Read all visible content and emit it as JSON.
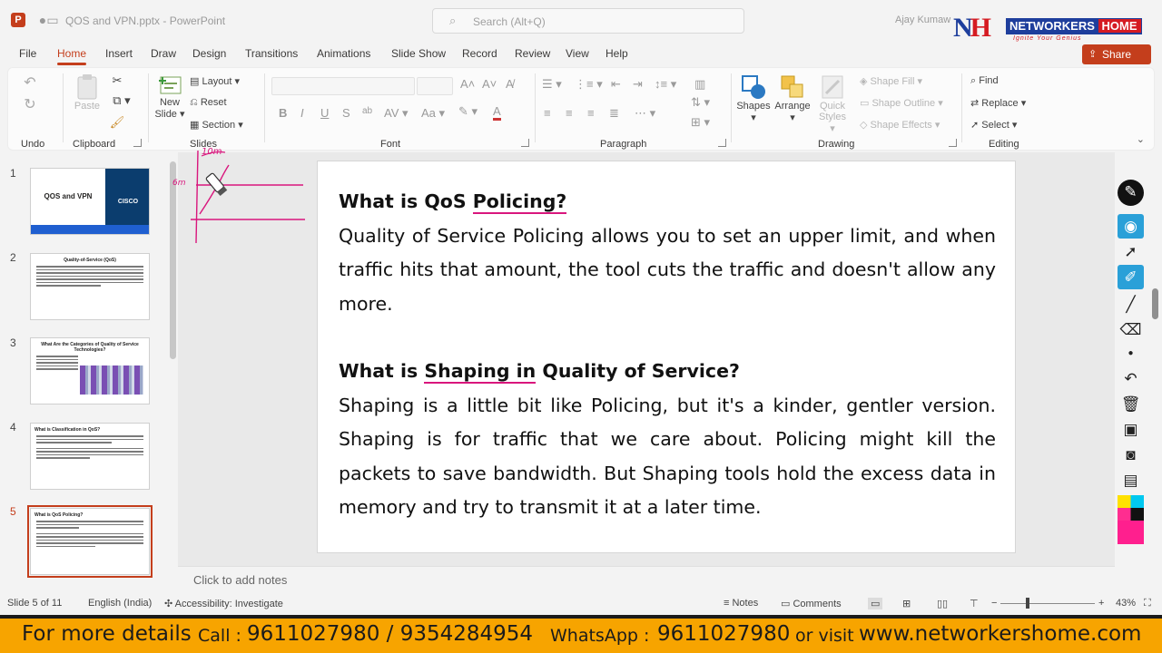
{
  "titlebar": {
    "app_logo": "P",
    "doc_title": "QOS and VPN.pptx  -  PowerPoint",
    "search_placeholder": "Search (Alt+Q)",
    "user": "Ajay Kumaw"
  },
  "brand": {
    "mark_n": "N",
    "mark_h": "H",
    "name_a": "NETWORKERS",
    "name_b": "HOME",
    "tagline": "Ignite Your Genius"
  },
  "menu": {
    "items": [
      "File",
      "Home",
      "Insert",
      "Draw",
      "Design",
      "Transitions",
      "Animations",
      "Slide Show",
      "Record",
      "Review",
      "View",
      "Help"
    ],
    "share": "Share"
  },
  "ribbon": {
    "groups": {
      "undo": "Undo",
      "clipboard": "Clipboard",
      "slides": "Slides",
      "font": "Font",
      "paragraph": "Paragraph",
      "drawing": "Drawing",
      "editing": "Editing"
    },
    "paste": "Paste",
    "new_slide": "New",
    "new_slide2": "Slide",
    "layout": "Layout",
    "reset": "Reset",
    "section": "Section",
    "bold": "B",
    "italic": "I",
    "underline": "U",
    "strike": "S",
    "shapes": "Shapes",
    "arrange": "Arrange",
    "quick": "Quick",
    "styles": "Styles",
    "shape_fill": "Shape Fill",
    "shape_outline": "Shape Outline",
    "shape_effects": "Shape Effects",
    "find": "Find",
    "replace": "Replace",
    "select": "Select"
  },
  "thumbnails": [
    {
      "num": "1",
      "title": "QOS and VPN",
      "brand": "CISCO"
    },
    {
      "num": "2",
      "title": "Quality-of-Service (QoS)"
    },
    {
      "num": "3",
      "title": "What Are the Categories of Quality of Service Technologies?"
    },
    {
      "num": "4",
      "title": "What is Classification in QoS?"
    },
    {
      "num": "5",
      "title": "What is QoS Policing?"
    }
  ],
  "slide": {
    "h1_a": "What is QoS ",
    "h1_b": "Policing?",
    "p1": "Quality of Service Policing allows you to set an upper limit, and when traffic hits that amount, the tool cuts the traffic and doesn't allow any more.",
    "h2_a": "What is ",
    "h2_b": "Shaping in",
    "h2_c": " Quality of Service?",
    "p2": "Shaping is a little bit like Policing, but it's a kinder, gentler version. Shaping is for traffic that we care about. Policing might kill the packets to save bandwidth. But Shaping tools hold the excess data in memory and try to transmit it at a later time."
  },
  "ink": {
    "a": "10m",
    "b": "6m"
  },
  "notes_placeholder": "Click to add notes",
  "status": {
    "slide": "Slide 5 of 11",
    "language": "English (India)",
    "accessibility": "Accessibility: Investigate",
    "notes": "Notes",
    "comments": "Comments",
    "zoom": "43%"
  },
  "promo": {
    "a": "For more details",
    "b": "Call : ",
    "c": "9611027980 / 9354284954",
    "d": "WhatsApp : ",
    "e": "9611027980",
    "f": "or visit ",
    "g": "www.networkershome.com"
  },
  "colors": {
    "accent": "#c43e1c",
    "ink": "#d9167d",
    "banner": "#f7a400"
  }
}
